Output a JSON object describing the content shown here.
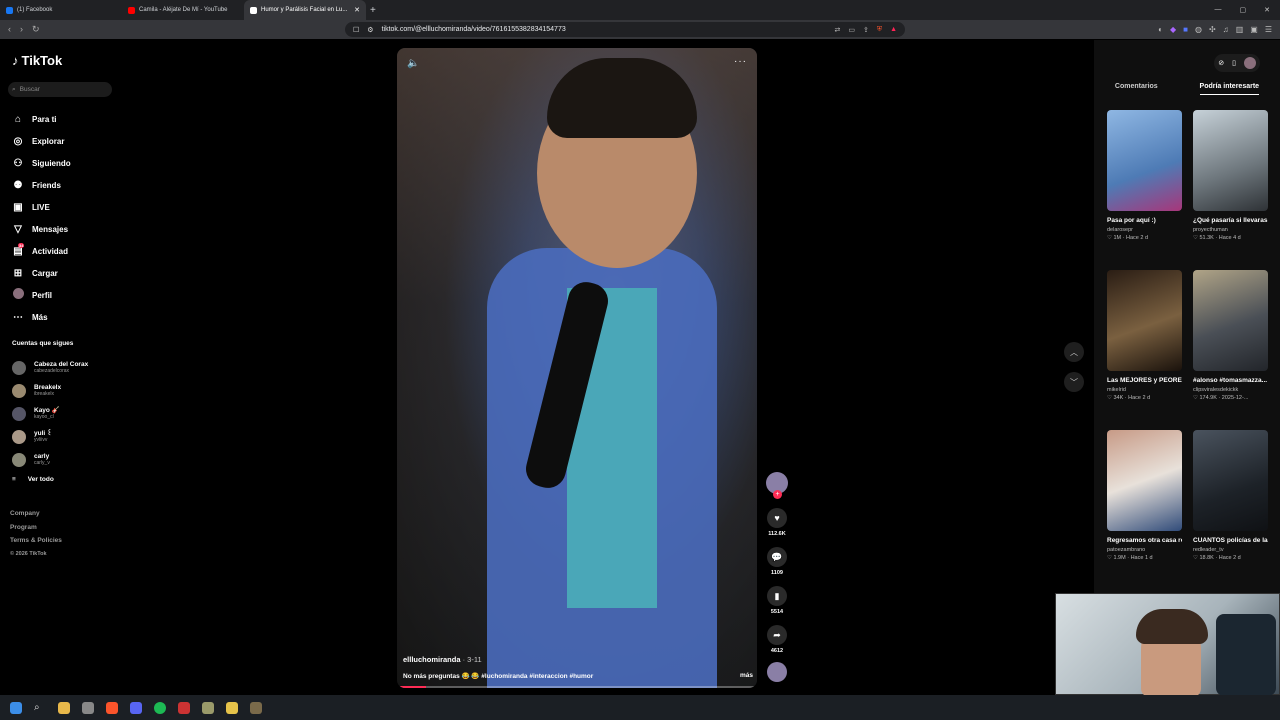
{
  "browser": {
    "tabs": [
      {
        "title": "(1) Facebook",
        "color": "#1877f2"
      },
      {
        "title": "Camila - Aléjate De Mí - YouTube",
        "color": "#ff0000"
      },
      {
        "title": "Humor y Parálisis Facial en Lu...",
        "color": "#ffffff"
      }
    ],
    "new_tab": "+",
    "url": "tiktok.com/@ellluchomiranda/video/7616155382834154773",
    "window_controls": [
      "—",
      "▢",
      "✕"
    ]
  },
  "sidebar": {
    "logo": "TikTok",
    "search_placeholder": "Buscar",
    "nav": [
      {
        "label": "Para ti",
        "icon": "home-icon",
        "glyph": "⌂"
      },
      {
        "label": "Explorar",
        "icon": "compass-icon",
        "glyph": "◎"
      },
      {
        "label": "Siguiendo",
        "icon": "following-icon",
        "glyph": "⚇"
      },
      {
        "label": "Friends",
        "icon": "friends-icon",
        "glyph": "⚉"
      },
      {
        "label": "LIVE",
        "icon": "live-icon",
        "glyph": "▣"
      },
      {
        "label": "Mensajes",
        "icon": "messages-icon",
        "glyph": "▽"
      },
      {
        "label": "Actividad",
        "icon": "activity-icon",
        "glyph": "▤",
        "badge": "34"
      },
      {
        "label": "Cargar",
        "icon": "upload-icon",
        "glyph": "⊞"
      },
      {
        "label": "Perfil",
        "icon": "profile-icon",
        "glyph": "●"
      },
      {
        "label": "Más",
        "icon": "more-icon",
        "glyph": "⋯"
      }
    ],
    "following_title": "Cuentas que sigues",
    "following": [
      {
        "name": "Cabeza del Corax",
        "user": "cabezadelcorax"
      },
      {
        "name": "Breakelx",
        "user": "ibreakelx"
      },
      {
        "name": "Kayo 🎸",
        "user": "kayoo_cl"
      },
      {
        "name": "yuli ꒰",
        "user": "yvliivv"
      },
      {
        "name": "carly",
        "user": "carly_v"
      }
    ],
    "ver_todo": "Ver todo",
    "footer": [
      "Company",
      "Program",
      "Terms & Policies"
    ],
    "copyright": "© 2026 TikTok"
  },
  "video": {
    "username": "ellluchomiranda",
    "date": " · 3-11",
    "description": "No más preguntas 😂 😂 #luchomiranda #interaccion #humor",
    "more_label": "más",
    "progress": 0.08
  },
  "actions": {
    "likes": "112.6K",
    "comments": "1109",
    "saves": "5514",
    "shares": "4612"
  },
  "right_panel": {
    "tabs": [
      "Comentarios",
      "Podría interesarte"
    ],
    "active_tab": 1,
    "cards": [
      {
        "title": "Pasa por aquí :)",
        "user": "delarosepr",
        "meta": "♡ 1M · Hace 2 d",
        "color": "#7aa6d6"
      },
      {
        "title": "¿Qué pasaría si llevaras un...",
        "user": "proyecthuman",
        "meta": "♡ 51.3K · Hace 4 d",
        "color": "#9aa3a8"
      },
      {
        "title": "Las MEJORES y PEORES portada...",
        "user": "mikelrid",
        "meta": "♡ 34K · Hace 2 d",
        "color": "#4d3b2a"
      },
      {
        "title": "#alonso #tomasmazza...",
        "user": "clipsviralesdekickk",
        "meta": "♡ 174.9K · 2025-12-...",
        "color": "#5a5f66"
      },
      {
        "title": "Regresamos otra casa robada con...",
        "user": "patoezambrano",
        "meta": "♡ 1.9M · Hace 1 d",
        "color": "#b9a79b"
      },
      {
        "title": "CUANTOS policías de la RPD...",
        "user": "redleader_tv",
        "meta": "♡ 18.8K · Hace 2 d",
        "color": "#2c3138"
      }
    ]
  }
}
